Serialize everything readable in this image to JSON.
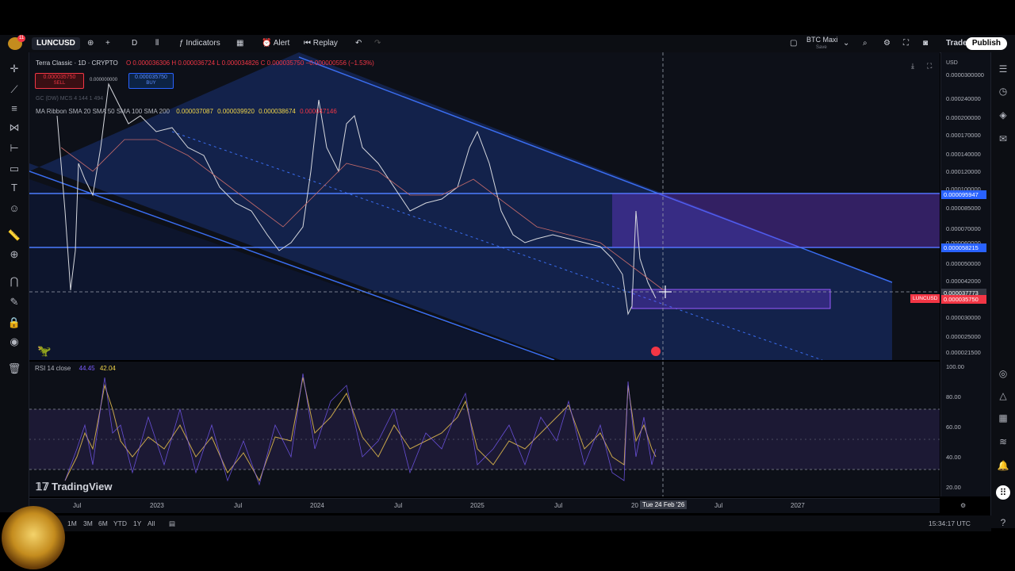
{
  "toolbar": {
    "symbol": "LUNCUSD",
    "interval": "D",
    "indicators_label": "Indicators",
    "alert_label": "Alert",
    "replay_label": "Replay",
    "layout_name": "BTC Maxi",
    "layout_status": "Save",
    "trade_label": "Trade",
    "publish_label": "Publish",
    "badge_count": "11"
  },
  "legend": {
    "title": "Terra Classic · 1D · CRYPTO",
    "ohlc": "O 0.000036306  H 0.000036724  L 0.000034826  C 0.000035750  −0.000000556 (−1.53%)",
    "sell_price": "0.000035750",
    "sell_label": "SELL",
    "spread": "0.000000000",
    "buy_price": "0.000035750",
    "buy_label": "BUY",
    "gc_line": "GC (DW) MCS 4 144 1 494",
    "ma_name": "MA Ribbon SMA 20 SMA 50 SMA 100 SMA 200",
    "ma_values": [
      "0.000037087",
      "0.000039920",
      "0.000038674",
      "0.000047146"
    ],
    "rsi_name": "RSI 14 close",
    "rsi_values": [
      "44.45",
      "42.04"
    ]
  },
  "price_axis": {
    "currency": "USD",
    "ticks": [
      "0.0000300000",
      "0.000240000",
      "0.000200000",
      "0.000170000",
      "0.000140000",
      "0.000120000",
      "0.000100000",
      "0.000085000",
      "0.000070000",
      "0.000060000",
      "0.000050000",
      "0.000042000",
      "0.000035000",
      "0.000030000",
      "0.000025000",
      "0.000021500"
    ],
    "label_upper": "0.000095947",
    "label_lower": "0.000058215",
    "label_current": "0.000037773",
    "label_last": "0.000035750",
    "label_symbol": "LUNCUSD"
  },
  "rsi_axis": {
    "ticks": [
      "100.00",
      "80.00",
      "60.00",
      "40.00",
      "20.00"
    ]
  },
  "time_axis": {
    "ticks": [
      "Jul",
      "2023",
      "Jul",
      "2024",
      "Jul",
      "2025",
      "Jul",
      "20",
      "Jul",
      "2027"
    ],
    "crosshair_date": "Tue 24 Feb '26"
  },
  "bottom": {
    "ranges": [
      "1M",
      "3M",
      "6M",
      "YTD",
      "1Y",
      "All"
    ],
    "clock": "15:34:17 UTC",
    "watermark": "TradingView"
  },
  "colors": {
    "accent": "#2962ff",
    "channel": "#3a6df0",
    "zone": "#7b3ff2",
    "rsi_line": "#c8a64a",
    "sell": "#f23645"
  }
}
